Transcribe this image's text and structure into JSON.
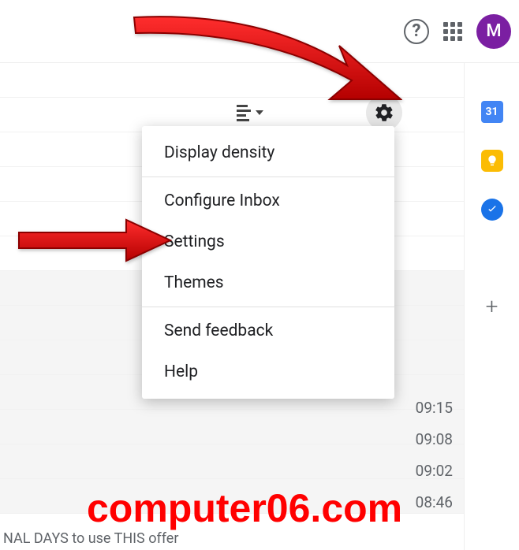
{
  "header": {
    "avatar_initial": "M"
  },
  "toolbar": {
    "gear_tooltip": "Settings"
  },
  "menu": {
    "items": [
      "Display density",
      "Configure Inbox",
      "Settings",
      "Themes",
      "Send feedback",
      "Help"
    ]
  },
  "sidebar": {
    "calendar_day": "31"
  },
  "times": [
    "09:15",
    "09:08",
    "09:02",
    "08:46"
  ],
  "watermark": "computer06.com",
  "bottom_text": "NAL DAYS to use THIS offer"
}
